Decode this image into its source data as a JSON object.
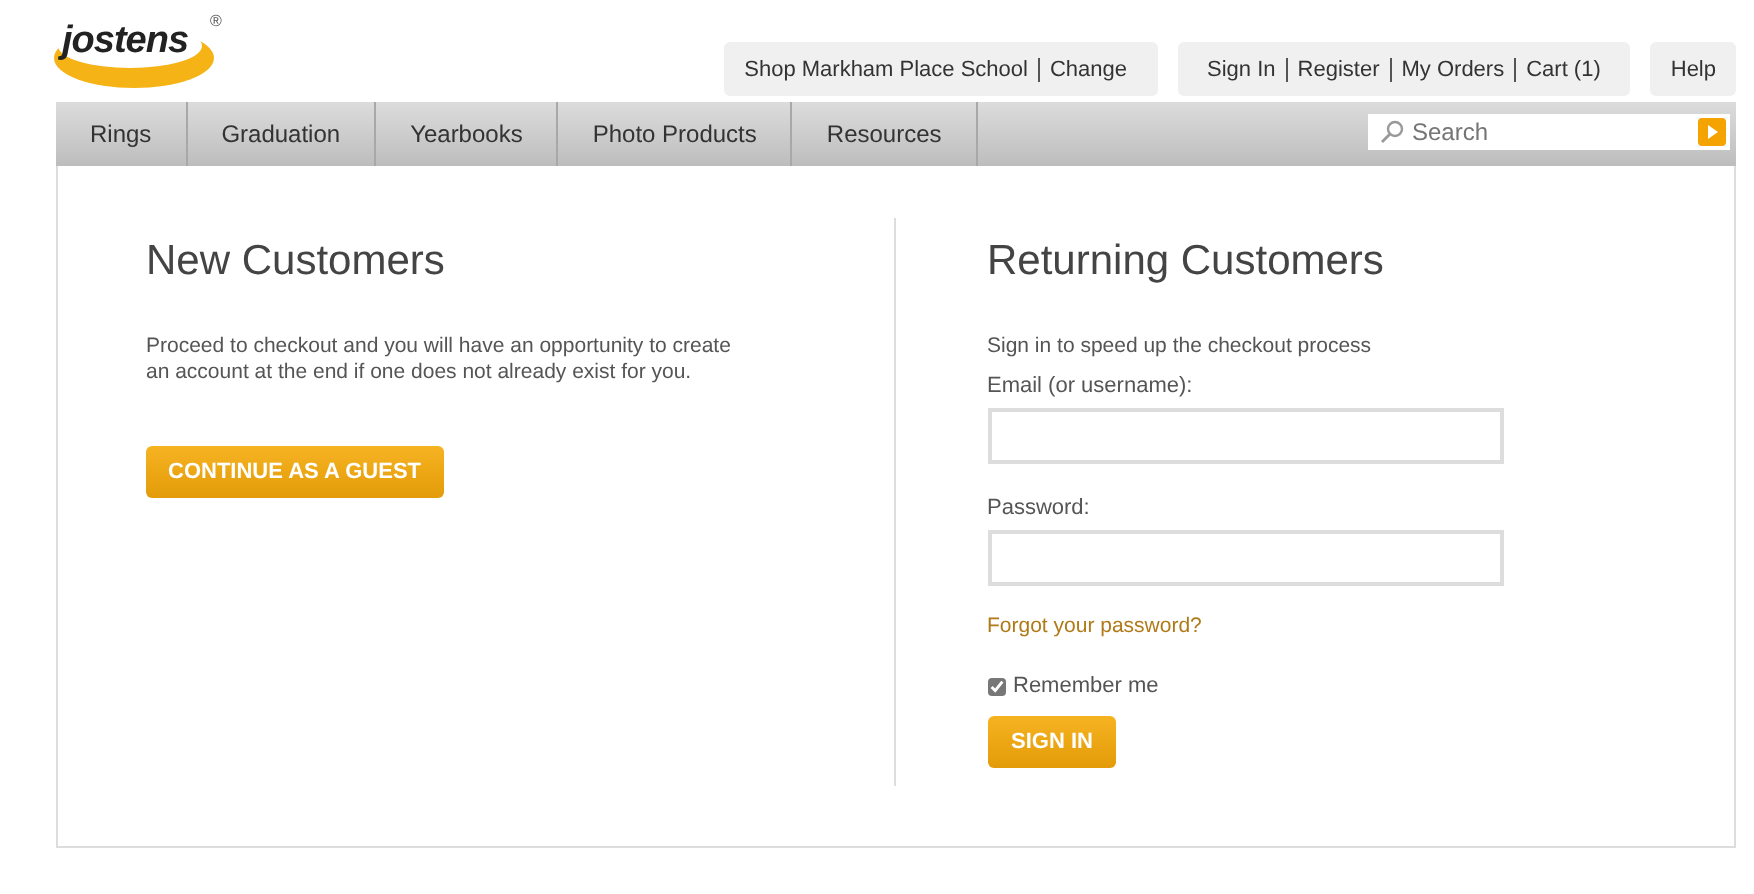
{
  "logo": {
    "text": "jostens",
    "mark": "®"
  },
  "school_bar": {
    "label": "Shop Markham Place School",
    "link": "Change"
  },
  "account_links": [
    "Sign In",
    "Register",
    "My Orders",
    "Cart (1)"
  ],
  "help": "Help",
  "nav": [
    "Rings",
    "Graduation",
    "Yearbooks",
    "Photo Products",
    "Resources"
  ],
  "search": {
    "placeholder": "Search"
  },
  "new_customers": {
    "title": "New Customers",
    "text": "Proceed to checkout and you will have an opportunity to create an account at the end if one does not already exist for you.",
    "button": "CONTINUE AS A GUEST"
  },
  "returning_customers": {
    "title": "Returning Customers",
    "intro": "Sign in to speed up the checkout process",
    "email_label": "Email (or username):",
    "password_label": "Password:",
    "forgot": "Forgot your password?",
    "remember": {
      "label": "Remember me",
      "checked": true
    },
    "button": "SIGN IN"
  }
}
